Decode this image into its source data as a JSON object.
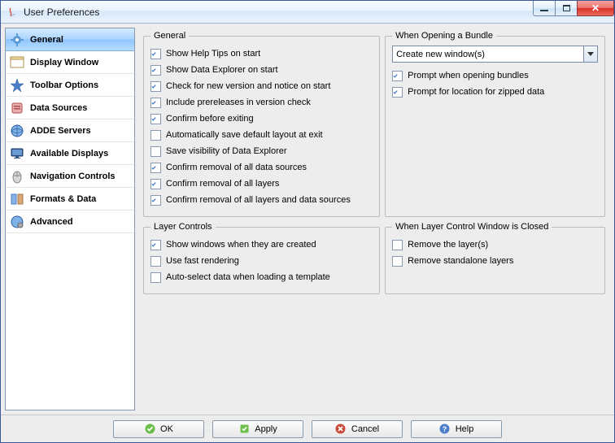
{
  "window": {
    "title": "User Preferences"
  },
  "sidebar": {
    "items": [
      {
        "label": "General",
        "icon": "gear-blue",
        "selected": true
      },
      {
        "label": "Display Window",
        "icon": "window",
        "selected": false
      },
      {
        "label": "Toolbar Options",
        "icon": "toolbar",
        "selected": false
      },
      {
        "label": "Data Sources",
        "icon": "datasource",
        "selected": false
      },
      {
        "label": "ADDE Servers",
        "icon": "globe",
        "selected": false
      },
      {
        "label": "Available Displays",
        "icon": "monitor",
        "selected": false
      },
      {
        "label": "Navigation Controls",
        "icon": "mouse",
        "selected": false
      },
      {
        "label": "Formats & Data",
        "icon": "formats",
        "selected": false
      },
      {
        "label": "Advanced",
        "icon": "globe-gear",
        "selected": false
      }
    ]
  },
  "groups": {
    "general": {
      "legend": "General",
      "items": [
        {
          "label": "Show Help Tips on start",
          "checked": true
        },
        {
          "label": "Show Data Explorer on start",
          "checked": true
        },
        {
          "label": "Check for new version and notice on start",
          "checked": true
        },
        {
          "label": "Include prereleases in version check",
          "checked": true
        },
        {
          "label": "Confirm before exiting",
          "checked": true
        },
        {
          "label": "Automatically save default layout at exit",
          "checked": false
        },
        {
          "label": "Save visibility of Data Explorer",
          "checked": false
        },
        {
          "label": "Confirm removal of all data sources",
          "checked": true
        },
        {
          "label": "Confirm removal of all layers",
          "checked": true
        },
        {
          "label": "Confirm removal of all layers and data sources",
          "checked": true
        }
      ]
    },
    "bundle": {
      "legend": "When Opening a Bundle",
      "combo": "Create new window(s)",
      "items": [
        {
          "label": "Prompt when opening bundles",
          "checked": true
        },
        {
          "label": "Prompt for location for zipped data",
          "checked": true
        }
      ]
    },
    "layer_controls": {
      "legend": "Layer Controls",
      "items": [
        {
          "label": "Show windows when they are created",
          "checked": true
        },
        {
          "label": "Use fast rendering",
          "checked": false
        },
        {
          "label": "Auto-select data when loading a template",
          "checked": false
        }
      ]
    },
    "layer_closed": {
      "legend": "When Layer Control Window is Closed",
      "items": [
        {
          "label": "Remove the layer(s)",
          "checked": false
        },
        {
          "label": "Remove standalone layers",
          "checked": false
        }
      ]
    }
  },
  "buttons": {
    "ok": "OK",
    "apply": "Apply",
    "cancel": "Cancel",
    "help": "Help"
  }
}
